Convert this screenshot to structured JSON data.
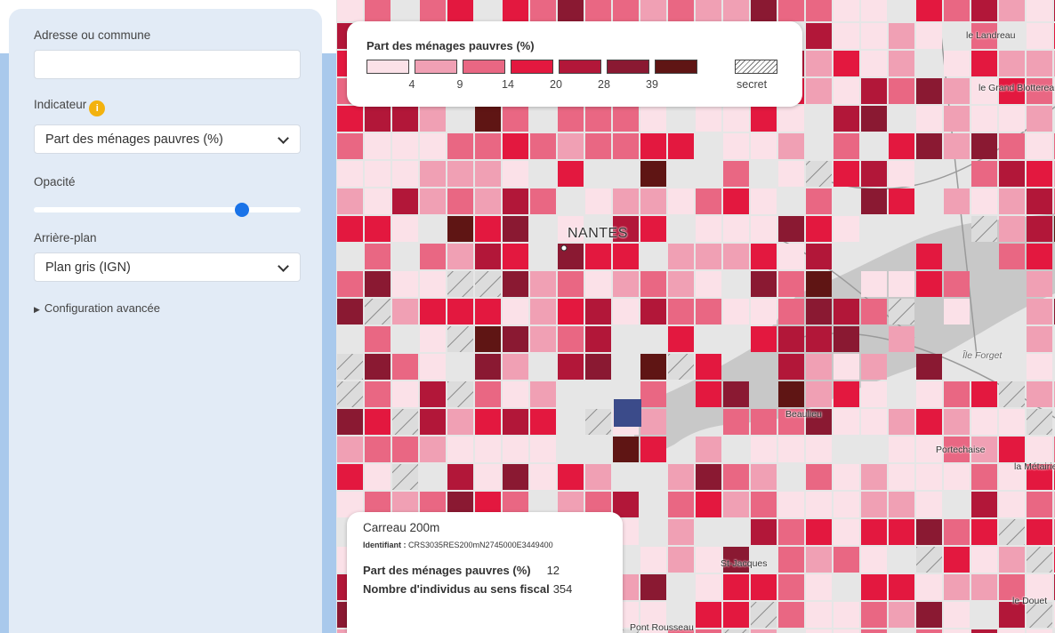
{
  "sidebar": {
    "address_label": "Adresse ou commune",
    "address_value": "",
    "indicator_label": "Indicateur",
    "indicator_info_icon": "info-icon",
    "indicator_info_glyph": "i",
    "indicator_value": "Part des ménages pauvres (%)",
    "opacity_label": "Opacité",
    "opacity_value": 0.78,
    "background_label": "Arrière-plan",
    "background_value": "Plan gris (IGN)",
    "advanced_label": "Configuration avancée"
  },
  "legend": {
    "title": "Part des ménages pauvres (%)",
    "colors": [
      "#fbe1e8",
      "#f0a0b4",
      "#e96783",
      "#e3183f",
      "#b21739",
      "#8a1932",
      "#5f1514"
    ],
    "ticks": [
      "4",
      "9",
      "14",
      "20",
      "28",
      "39"
    ],
    "secret_label": "secret"
  },
  "map": {
    "places": [
      {
        "id": "nantes",
        "label": "NANTES"
      },
      {
        "id": "le-landreau",
        "label": "le Landreau"
      },
      {
        "id": "le-grand-blottereau",
        "label": "le Grand Blottereau"
      },
      {
        "id": "ile-forget",
        "label": "Île Forget"
      },
      {
        "id": "beaulieu",
        "label": "Beaulieu"
      },
      {
        "id": "portechaise",
        "label": "Portechaise"
      },
      {
        "id": "la-metairie",
        "label": "la Métairie"
      },
      {
        "id": "st-jacques",
        "label": "St-Jacques"
      },
      {
        "id": "le-douet",
        "label": "le Douet"
      },
      {
        "id": "pont-rousseau",
        "label": "Pont Rousseau"
      }
    ]
  },
  "popup": {
    "title": "Carreau 200m",
    "id_label": "Identifiant :",
    "id_value": "CRS3035RES200mN2745000E3449400",
    "rows": [
      {
        "label": "Part des ménages pauvres (%)",
        "value": "12"
      },
      {
        "label": "Nombre d'individus au sens fiscal",
        "value": "354"
      }
    ]
  }
}
